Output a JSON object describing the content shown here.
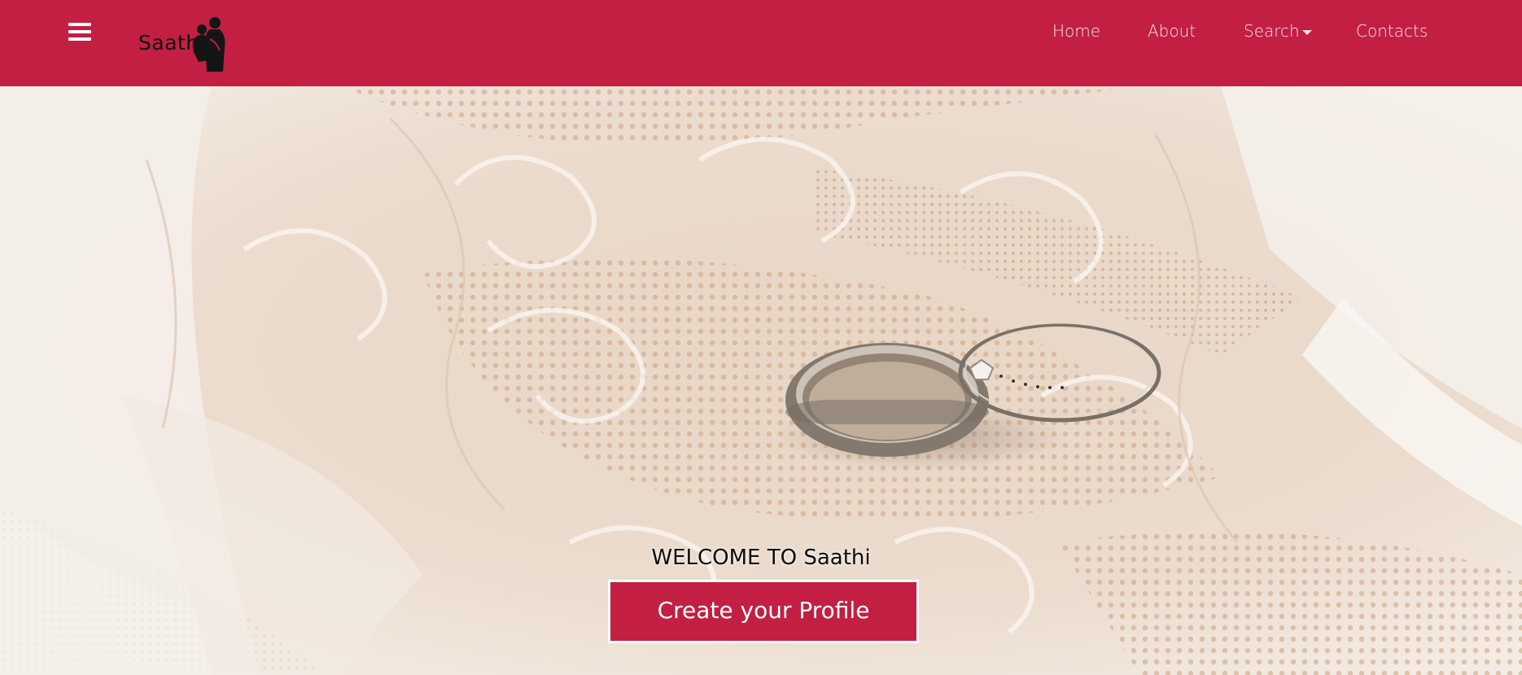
{
  "brand": {
    "name": "Saathi",
    "icon": "couple-silhouette-icon",
    "color": "#c21f43"
  },
  "menu": {
    "icon": "hamburger-menu-icon"
  },
  "nav": {
    "home": "Home",
    "about": "About",
    "search": "Search",
    "search_icon": "caret-down-icon",
    "contacts": "Contacts"
  },
  "hero": {
    "image": "wedding-rings-on-lace",
    "welcome": "WELCOME TO Saathi",
    "cta_label": "Create your Profile"
  }
}
